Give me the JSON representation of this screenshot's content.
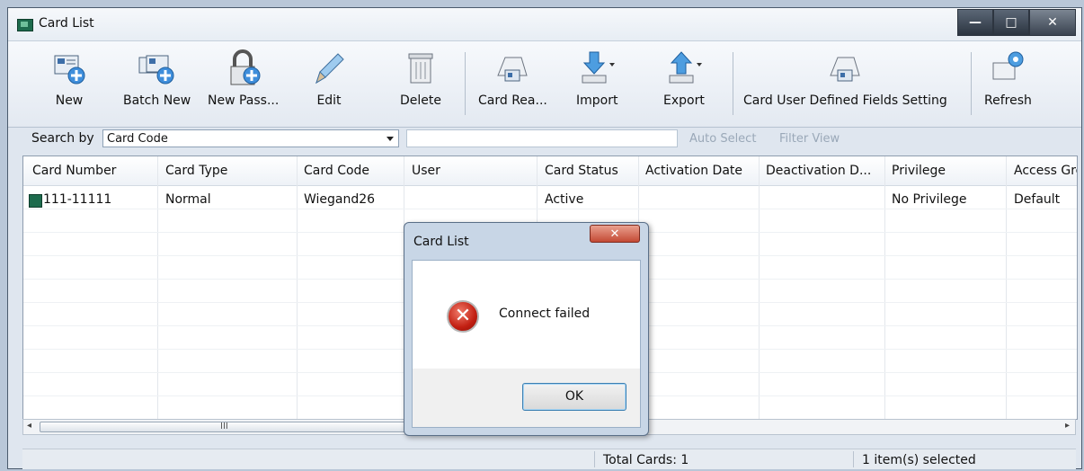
{
  "window": {
    "title": "Card List",
    "controls": [
      "—",
      "□",
      "✕"
    ]
  },
  "toolbar": {
    "buttons": [
      {
        "label": "New"
      },
      {
        "label": "Batch New"
      },
      {
        "label": "New Pass..."
      },
      {
        "label": "Edit"
      },
      {
        "label": "Delete"
      },
      {
        "label": "Card Rea..."
      },
      {
        "label": "Import"
      },
      {
        "label": "Export"
      },
      {
        "label": "Card User Defined Fields Setting"
      },
      {
        "label": "Refresh"
      }
    ]
  },
  "search": {
    "label": "Search by",
    "field_value": "Card Code",
    "query": "",
    "auto_select": "Auto Select",
    "filter_view": "Filter View"
  },
  "table": {
    "columns": [
      "Card Number",
      "Card Type",
      "Card Code",
      "User",
      "Card Status",
      "Activation Date",
      "Deactivation D...",
      "Privilege",
      "Access Grc"
    ],
    "rows": [
      [
        "111-11111",
        "Normal",
        "Wiegand26",
        "",
        "Active",
        "",
        "",
        "No Privilege",
        "Default"
      ]
    ]
  },
  "scrollbar": {
    "left": "◂",
    "right": "▸",
    "grip": "III"
  },
  "status": {
    "total": "Total Cards: 1",
    "selected": "1 item(s) selected"
  },
  "dialog": {
    "title": "Card List",
    "close": "✕",
    "message": "Connect failed",
    "ok": "OK"
  }
}
